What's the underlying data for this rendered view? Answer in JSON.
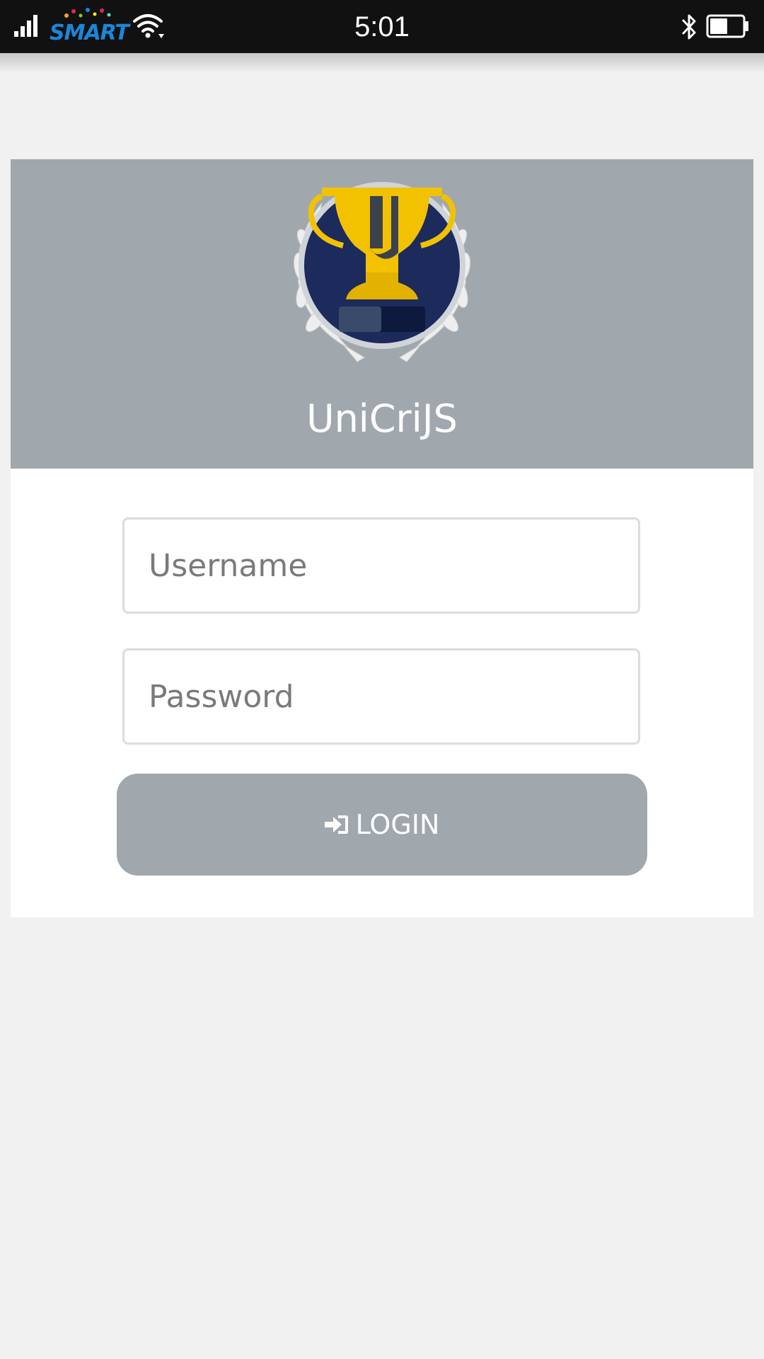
{
  "status_bar": {
    "time": "5:01",
    "carrier": "SMART",
    "icons": [
      "signal-icon",
      "wifi-icon",
      "bluetooth-icon",
      "battery-icon"
    ],
    "battery_level": 0.55,
    "signal_bars": 4
  },
  "app": {
    "title": "UniCriJS",
    "logo": "trophy-laurel-logo"
  },
  "login_form": {
    "username_placeholder": "Username",
    "username_value": "",
    "password_placeholder": "Password",
    "password_value": "",
    "login_label": "LOGIN",
    "login_icon": "sign-in-icon"
  },
  "colors": {
    "page_background": "#f1f1f1",
    "status_bar": "#111111",
    "header_background": "#a0a8ae",
    "button_background": "#a0a8ae",
    "card_background": "#ffffff",
    "trophy_gold": "#f2c200",
    "logo_navy": "#1c2a5c",
    "carrier_blue": "#1b86d8"
  }
}
